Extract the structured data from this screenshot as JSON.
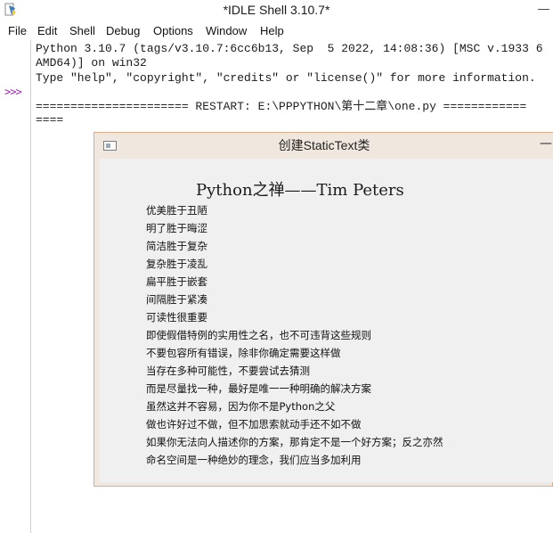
{
  "window": {
    "title": "*IDLE Shell 3.10.7*",
    "minimize_glyph": "—",
    "icon": "python-feather-icon"
  },
  "menu": [
    "File",
    "Edit",
    "Shell",
    "Debug",
    "Options",
    "Window",
    "Help"
  ],
  "shell": {
    "prompt": ">>>",
    "lines": [
      "Python 3.10.7 (tags/v3.10.7:6cc6b13, Sep  5 2022, 14:08:36) [MSC v.1933 6",
      "AMD64)] on win32",
      "Type \"help\", \"copyright\", \"credits\" or \"license()\" for more information.",
      "",
      "====================== RESTART: E:\\PPPYTHON\\第十二章\\one.py ============",
      "===="
    ]
  },
  "frame": {
    "title": "创建StaticText类",
    "minimize_glyph": "—",
    "heading": "Python之禅——Tim Peters",
    "lines": [
      "优美胜于丑陋",
      "明了胜于晦涩",
      "简洁胜于复杂",
      "复杂胜于凌乱",
      "扁平胜于嵌套",
      "间隔胜于紧凑",
      "可读性很重要",
      "即使假借特例的实用性之名，也不可违背这些规则",
      "不要包容所有错误，除非你确定需要这样做",
      "当存在多种可能性，不要尝试去猜测",
      "而是尽量找一种，最好是唯一一种明确的解决方案",
      "虽然这并不容易，因为你不是Python之父",
      "做也许好过不做，但不加思索就动手还不如不做",
      "如果你无法向人描述你的方案，那肯定不是一个好方案；反之亦然",
      "命名空间是一种绝妙的理念，我们应当多加利用"
    ]
  }
}
